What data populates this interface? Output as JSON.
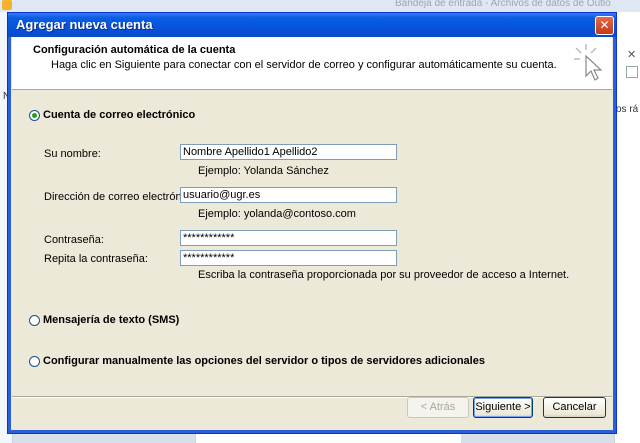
{
  "background": {
    "window_title": "Bandeja de entrada - Archivos de datos de Outlo",
    "right_panel_text": "os rá",
    "right_panel_close": "✕",
    "left_panel_text": "N"
  },
  "dialog": {
    "title": "Agregar nueva cuenta",
    "close_label": "✕",
    "header": {
      "title": "Configuración automática de la cuenta",
      "subtitle": "Haga clic en Siguiente para conectar con el servidor de correo y configurar automáticamente su cuenta."
    },
    "options": {
      "email": "Cuenta de correo electrónico",
      "sms": "Mensajería de texto (SMS)",
      "manual": "Configurar manualmente las opciones del servidor o tipos de servidores adicionales"
    },
    "form": {
      "name_label": "Su nombre:",
      "name_value": "Nombre Apellido1 Apellido2",
      "name_hint": "Ejemplo: Yolanda Sánchez",
      "email_label": "Dirección de correo electrónico:",
      "email_value": "usuario@ugr.es",
      "email_hint": "Ejemplo: yolanda@contoso.com",
      "password_label": "Contraseña:",
      "password_value": "************",
      "confirm_label": "Repita la contraseña:",
      "confirm_value": "************",
      "password_hint": "Escriba la contraseña proporcionada por su proveedor de acceso a Internet."
    },
    "buttons": {
      "back": "< Atrás",
      "next": "Siguiente >",
      "cancel": "Cancelar"
    }
  }
}
